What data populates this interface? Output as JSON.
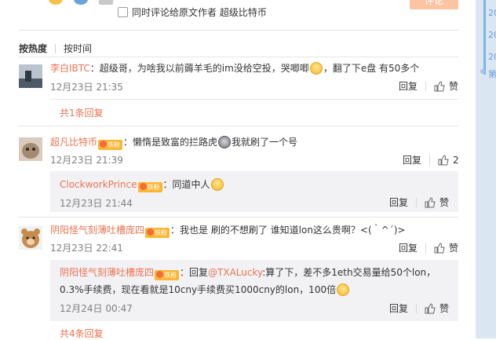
{
  "composer": {
    "sync_label": "同时评论给原文作者 超级比特币",
    "post_button": "评论"
  },
  "sort": {
    "active": "按热度",
    "other": "按时间"
  },
  "comments": [
    {
      "user": "李白IBTC",
      "text_pre": "：超级哥，为啥我以前薅羊毛的im没给空投，哭唧唧",
      "emoji": "crying-face",
      "text_post": "，翻了下e盘 有50多个",
      "time": "12月23日 21:35",
      "reply": "回复",
      "like": "赞",
      "fold": "共1条回复"
    },
    {
      "user": "超凡比特币",
      "badge": "铁粉",
      "text_pre": "：懒惰是致富的拦路虎",
      "emoji": "tiger-face",
      "text_post": "我就刷了一个号",
      "time": "12月23日 21:39",
      "reply": "回复",
      "like_count": "2",
      "subreply": {
        "user": "ClockworkPrince",
        "badge": "铁粉",
        "text": "：同道中人",
        "emoji": "laughing-face",
        "time": "12月23日 21:44",
        "reply": "回复",
        "like": "赞"
      }
    },
    {
      "user": "阴阳怪气刻薄吐槽庞四",
      "badge": "铁粉",
      "text": "：我也是 刷的不想刷了 谁知道lon这么贵啊？<(｀^´)>",
      "time": "12月23日 22:41",
      "reply": "回复",
      "like": "赞",
      "subreply": {
        "user": "阴阳怪气刻薄吐槽庞四",
        "badge": "铁粉",
        "text_pre": "：回复",
        "mention": "@TXALucky",
        "text_line1": ":算了下，差不多1eth交易量给50个lon，",
        "text_line2": "0.3%手续费，现在看就是10cny手续费买1000cny的lon，100倍",
        "emoji": "laughing-face",
        "time": "12月24日 00:47",
        "reply": "回复",
        "like": "赞"
      },
      "fold": "共4条回复"
    }
  ],
  "sidebar": {
    "items": [
      "20",
      "20",
      "20",
      "第"
    ]
  }
}
